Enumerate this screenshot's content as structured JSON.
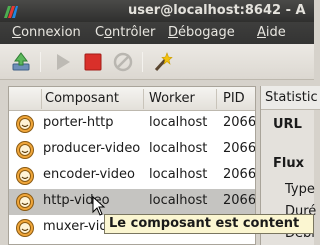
{
  "window": {
    "title": "user@localhost:8642 - A",
    "icon": "flumotion-admin-icon"
  },
  "menu": [
    {
      "label": "Connexion",
      "mnemonic": "C",
      "rest": "onnexion"
    },
    {
      "label": "Contrôler",
      "mnemonic": "o",
      "pre": "C",
      "rest": "ntrôler"
    },
    {
      "label": "Débogage",
      "mnemonic": "D",
      "rest": "ébogage"
    },
    {
      "label": "Aide",
      "mnemonic": "A",
      "rest": "ide"
    }
  ],
  "toolbar": {
    "buttons": [
      {
        "name": "open-recent-icon",
        "enabled": true
      },
      {
        "name": "start-icon",
        "enabled": false
      },
      {
        "name": "stop-icon",
        "enabled": true
      },
      {
        "name": "delete-icon",
        "enabled": false
      },
      {
        "name": "wizard-icon",
        "enabled": true
      }
    ]
  },
  "components_table": {
    "headers": {
      "component": "Composant",
      "worker": "Worker",
      "pid": "PID"
    },
    "rows": [
      {
        "name": "porter-http",
        "worker": "localhost",
        "pid": "2066",
        "status": "happy",
        "selected": false
      },
      {
        "name": "producer-video",
        "worker": "localhost",
        "pid": "2066",
        "status": "happy",
        "selected": false
      },
      {
        "name": "encoder-video",
        "worker": "localhost",
        "pid": "2066",
        "status": "happy",
        "selected": false
      },
      {
        "name": "http-video",
        "worker": "localhost",
        "pid": "2066",
        "status": "happy",
        "selected": true
      },
      {
        "name": "muxer-vid",
        "worker": "",
        "pid": "",
        "status": "happy",
        "selected": false
      }
    ]
  },
  "details_panel": {
    "tab_label": "Statistic",
    "url_label": "URL",
    "flux_label": "Flux",
    "type_label": "Type",
    "duree_label": "Duré",
    "debit_label": "Débi"
  },
  "tooltip": {
    "text": "Le composant est content"
  },
  "colors": {
    "status_happy": "#f0a63a",
    "stop_red": "#d9302a"
  }
}
